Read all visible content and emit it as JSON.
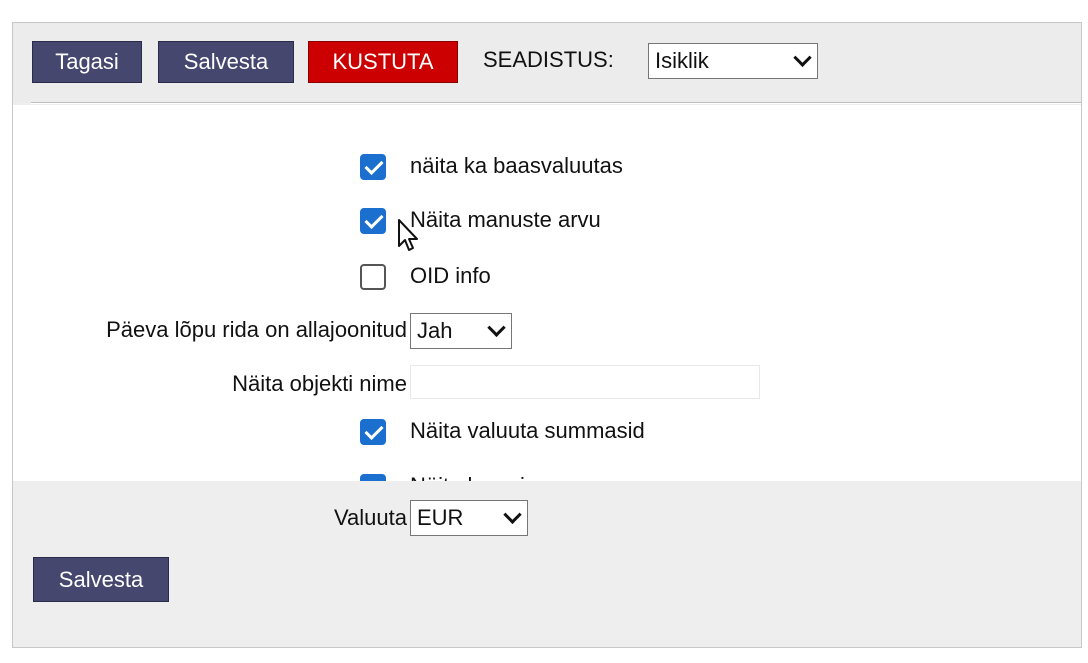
{
  "toolbar": {
    "back_label": "Tagasi",
    "save_label": "Salvesta",
    "delete_label": "KUSTUTA",
    "settings_label": "SEADISTUS:",
    "settings_value": "Isiklik"
  },
  "form": {
    "show_base_currency": {
      "label": "näita ka baasvaluutas",
      "checked": true
    },
    "show_attachment_count": {
      "label": "Näita manuste arvu",
      "checked": true
    },
    "oid_info": {
      "label": "OID info",
      "checked": false
    },
    "day_end_underlined": {
      "label": "Päeva lõpu rida on allajoonitud",
      "value": "Jah"
    },
    "show_object_name": {
      "label": "Näita objekti nime",
      "value": ""
    },
    "show_currency_sums": {
      "label": "Näita valuuta summasid",
      "checked": true
    },
    "show_rate": {
      "label": "Näita kurssi",
      "checked": true
    },
    "currency": {
      "label": "Valuuta",
      "value": "EUR"
    }
  },
  "footer": {
    "save_label": "Salvesta"
  },
  "colors": {
    "button_dark": "#45476f",
    "button_red": "#cc0000",
    "checkbox_blue": "#1a6fcf",
    "panel_bg": "#eeeeee"
  }
}
